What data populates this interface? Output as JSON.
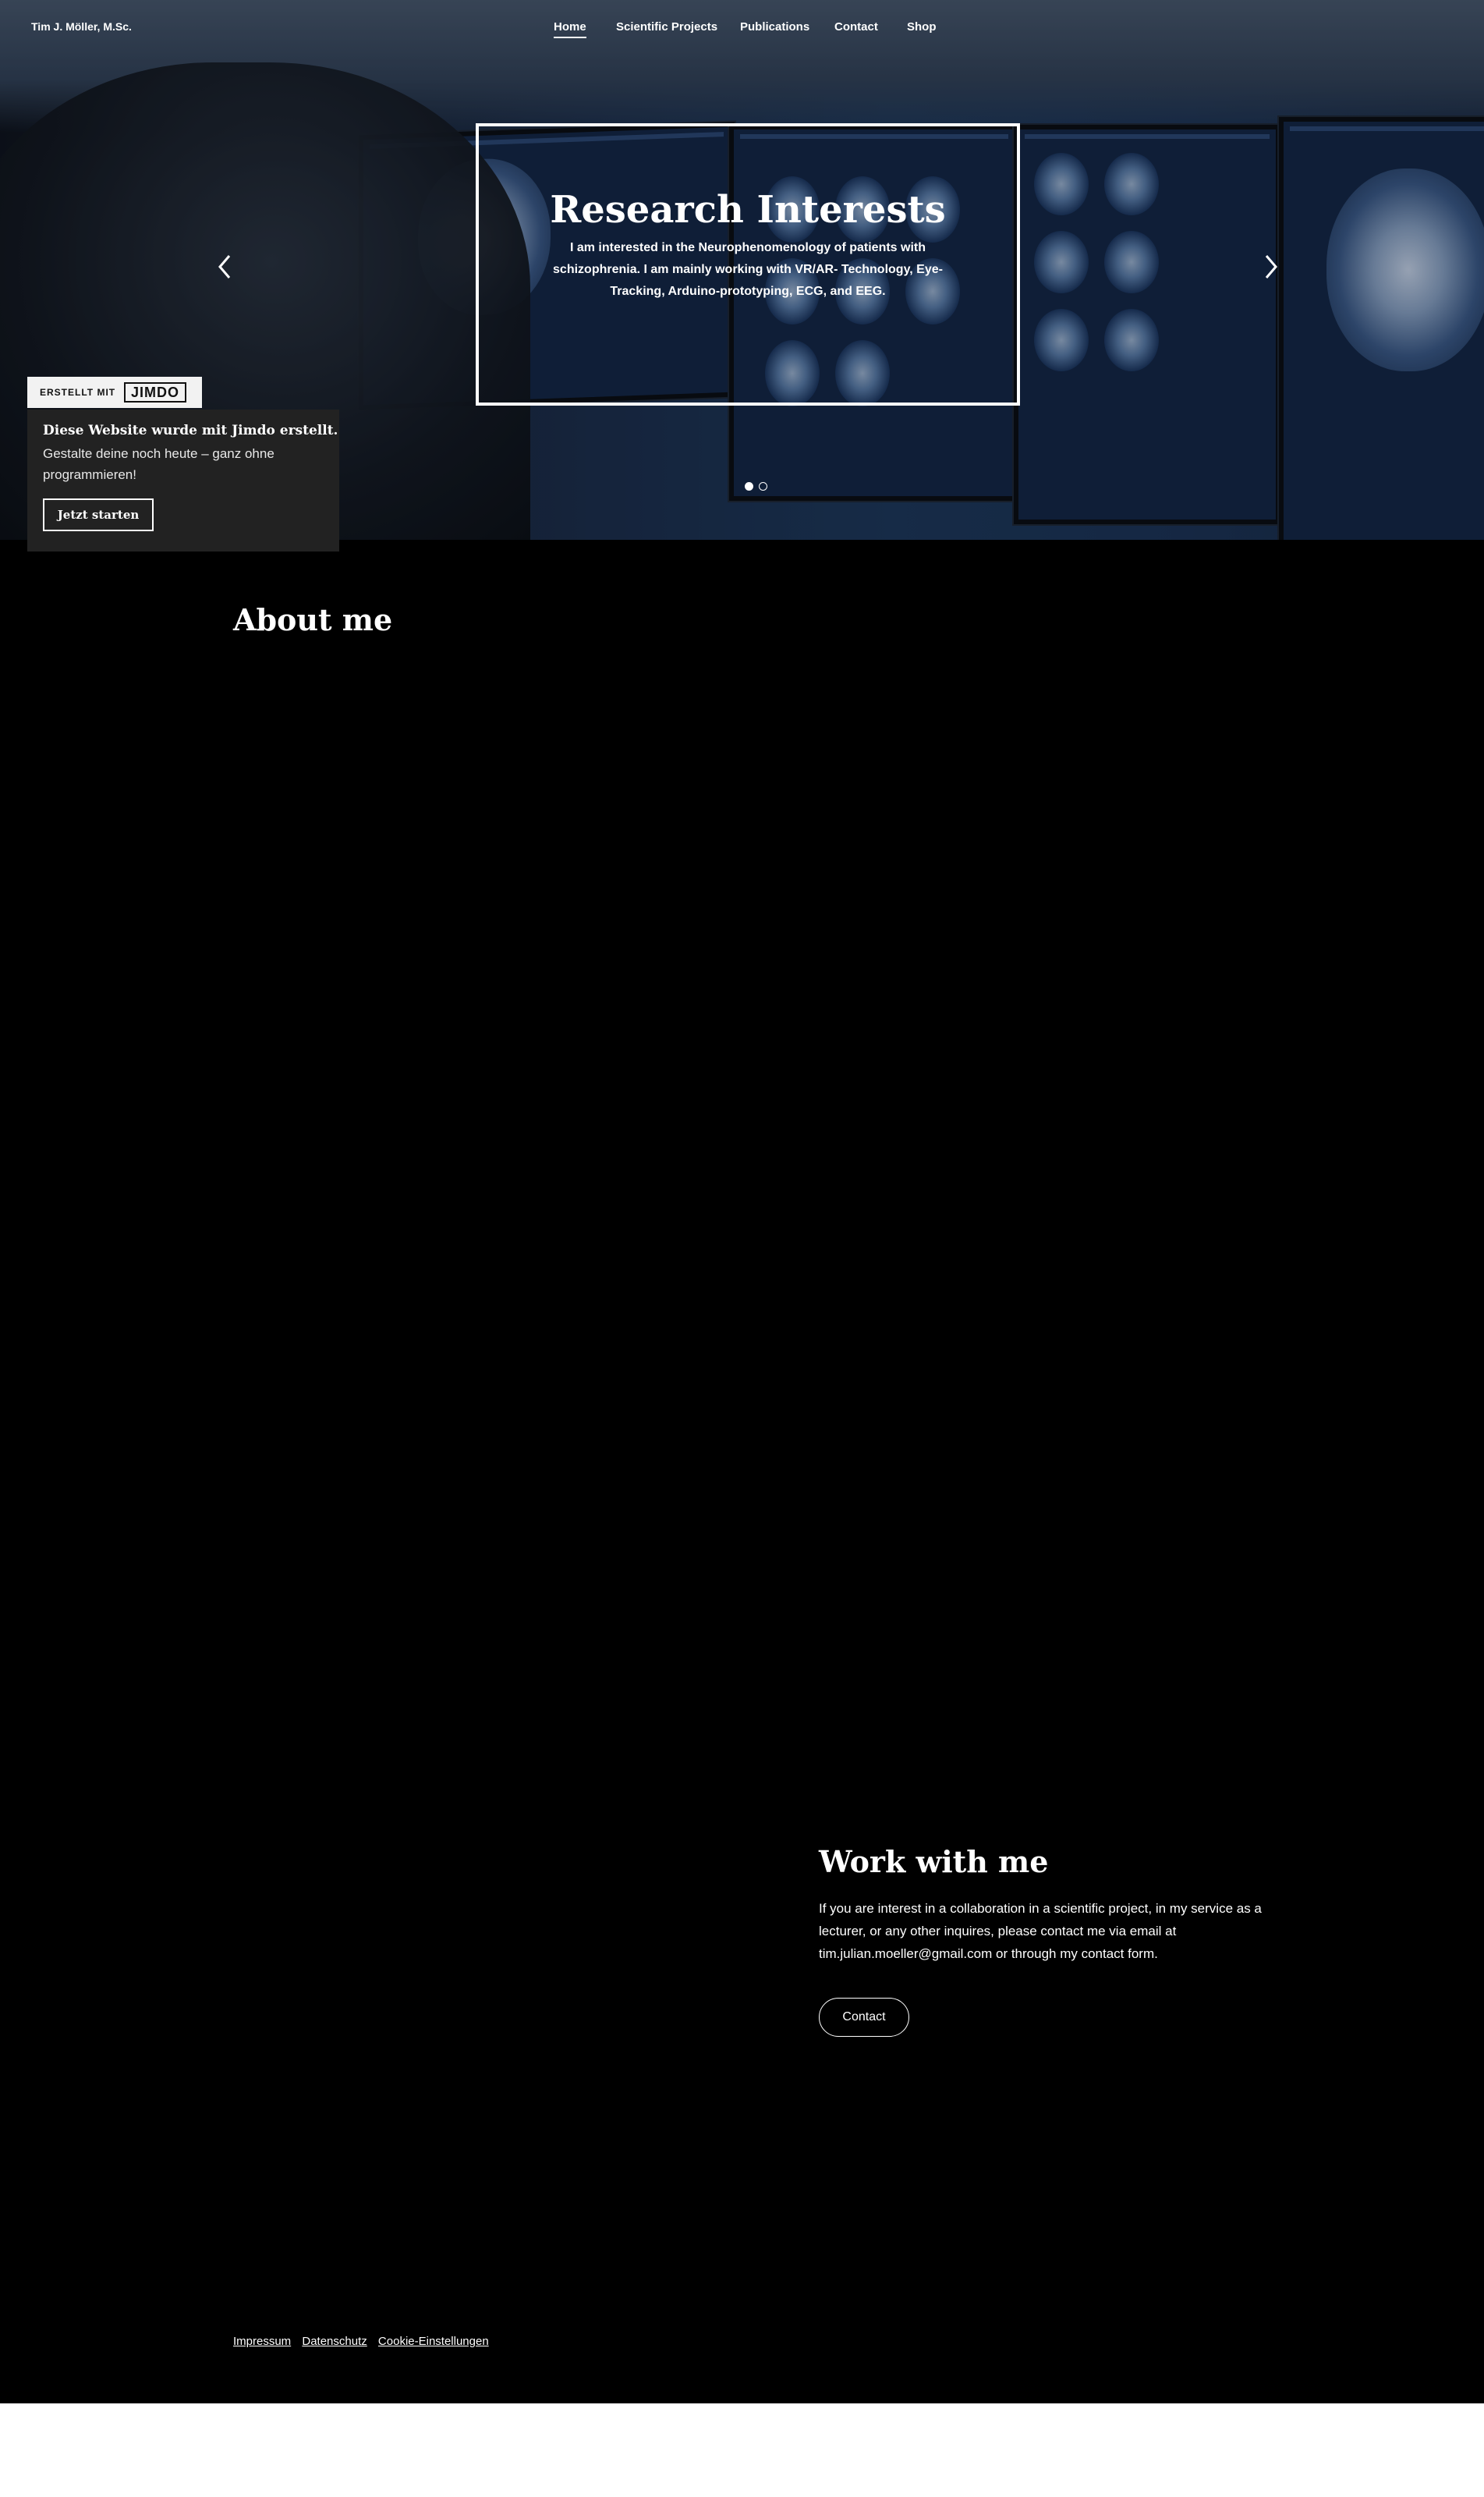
{
  "site": {
    "name": "Tim J. Möller, M.Sc."
  },
  "nav": {
    "items": [
      {
        "label": "Home",
        "active": true
      },
      {
        "label": "Scientific Projects"
      },
      {
        "label": "Publications"
      },
      {
        "label": "Contact"
      },
      {
        "label": "Shop"
      }
    ]
  },
  "hero": {
    "title": "Research Interests",
    "text": "I am interested in the Neurophenomenology of patients with schizophrenia. I am mainly working with VR/AR- Technology, Eye-Tracking, Arduino-prototyping, ECG, and EEG.",
    "prev_icon": "chevron-left-icon",
    "next_icon": "chevron-right-icon",
    "slide_count": 2,
    "active_slide": 1
  },
  "jimdo": {
    "badge_text": "ERSTELLT MIT",
    "logo_text": "JIMDO",
    "panel_title": "Diese Website wurde mit Jimdo erstellt.",
    "panel_text": "Gestalte deine noch heute – ganz ohne programmieren!",
    "button_label": "Jetzt starten"
  },
  "about": {
    "title": "About me"
  },
  "work": {
    "title": "Work with me",
    "text": "If you are interest in a collaboration in a scientific project,  in my service as a lecturer, or any other inquires,  please contact me via email at tim.julian.moeller@gmail.com or through my contact form.",
    "button_label": "Contact"
  },
  "footer": {
    "links": [
      "Impressum",
      "Datenschutz",
      "Cookie-Einstellungen"
    ]
  },
  "colors": {
    "background": "#000000",
    "text": "#ffffff",
    "jimdo_panel": "#222222"
  }
}
